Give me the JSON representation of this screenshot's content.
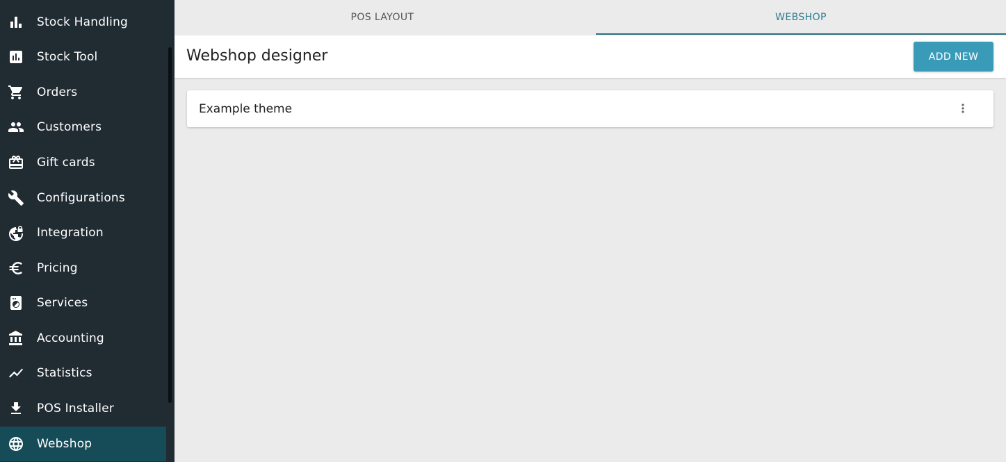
{
  "sidebar": {
    "items": [
      {
        "label": "Stock Handling",
        "icon": "bar-chart-icon"
      },
      {
        "label": "Stock Tool",
        "icon": "chart-box-icon"
      },
      {
        "label": "Orders",
        "icon": "shopping-cart-icon"
      },
      {
        "label": "Customers",
        "icon": "people-icon"
      },
      {
        "label": "Gift cards",
        "icon": "gift-card-icon"
      },
      {
        "label": "Configurations",
        "icon": "wrench-icon"
      },
      {
        "label": "Integration",
        "icon": "globe-lock-icon"
      },
      {
        "label": "Pricing",
        "icon": "euro-icon"
      },
      {
        "label": "Services",
        "icon": "washing-machine-icon"
      },
      {
        "label": "Accounting",
        "icon": "bank-icon"
      },
      {
        "label": "Statistics",
        "icon": "trending-up-icon"
      },
      {
        "label": "POS Installer",
        "icon": "download-icon"
      },
      {
        "label": "Webshop",
        "icon": "globe-icon",
        "active": true
      }
    ]
  },
  "tabs": [
    {
      "label": "POS LAYOUT",
      "active": false
    },
    {
      "label": "WEBSHOP",
      "active": true
    }
  ],
  "header": {
    "title": "Webshop designer",
    "add_new_label": "ADD NEW"
  },
  "themes": [
    {
      "name": "Example theme"
    }
  ],
  "colors": {
    "sidebar_bg": "#212b32",
    "sidebar_active": "#164c57",
    "accent": "#3a9bb8",
    "tab_active": "#2c7d93"
  }
}
